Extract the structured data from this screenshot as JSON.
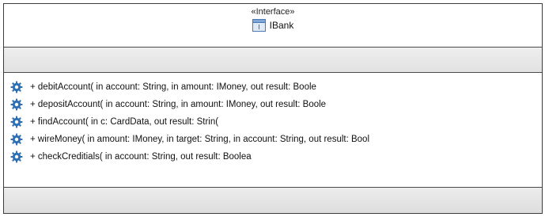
{
  "interface": {
    "stereotype": "«Interface»",
    "name": "IBank",
    "icon": "interface-icon"
  },
  "operations": [
    {
      "text": "+ debitAccount(  in account: String,    in amount: IMoney,    out result: Boole",
      "icon": "operation-gear-icon"
    },
    {
      "text": "+ depositAccount(  in account: String,    in amount: IMoney,    out result: Boole",
      "icon": "operation-gear-icon"
    },
    {
      "text": "+ findAccount(  in c: CardData,    out result: Strin(",
      "icon": "operation-gear-icon"
    },
    {
      "text": "+ wireMoney(  in amount: IMoney,    in target: String,    in account: String,    out result: Bool",
      "icon": "operation-gear-icon"
    },
    {
      "text": "+ checkCreditials(  in account: String,    out result: Boolea",
      "icon": "operation-gear-icon"
    }
  ],
  "colors": {
    "border": "#3c3c3c",
    "compartment_fill": "#e6e6e6",
    "gear": "#2f6fb3"
  }
}
